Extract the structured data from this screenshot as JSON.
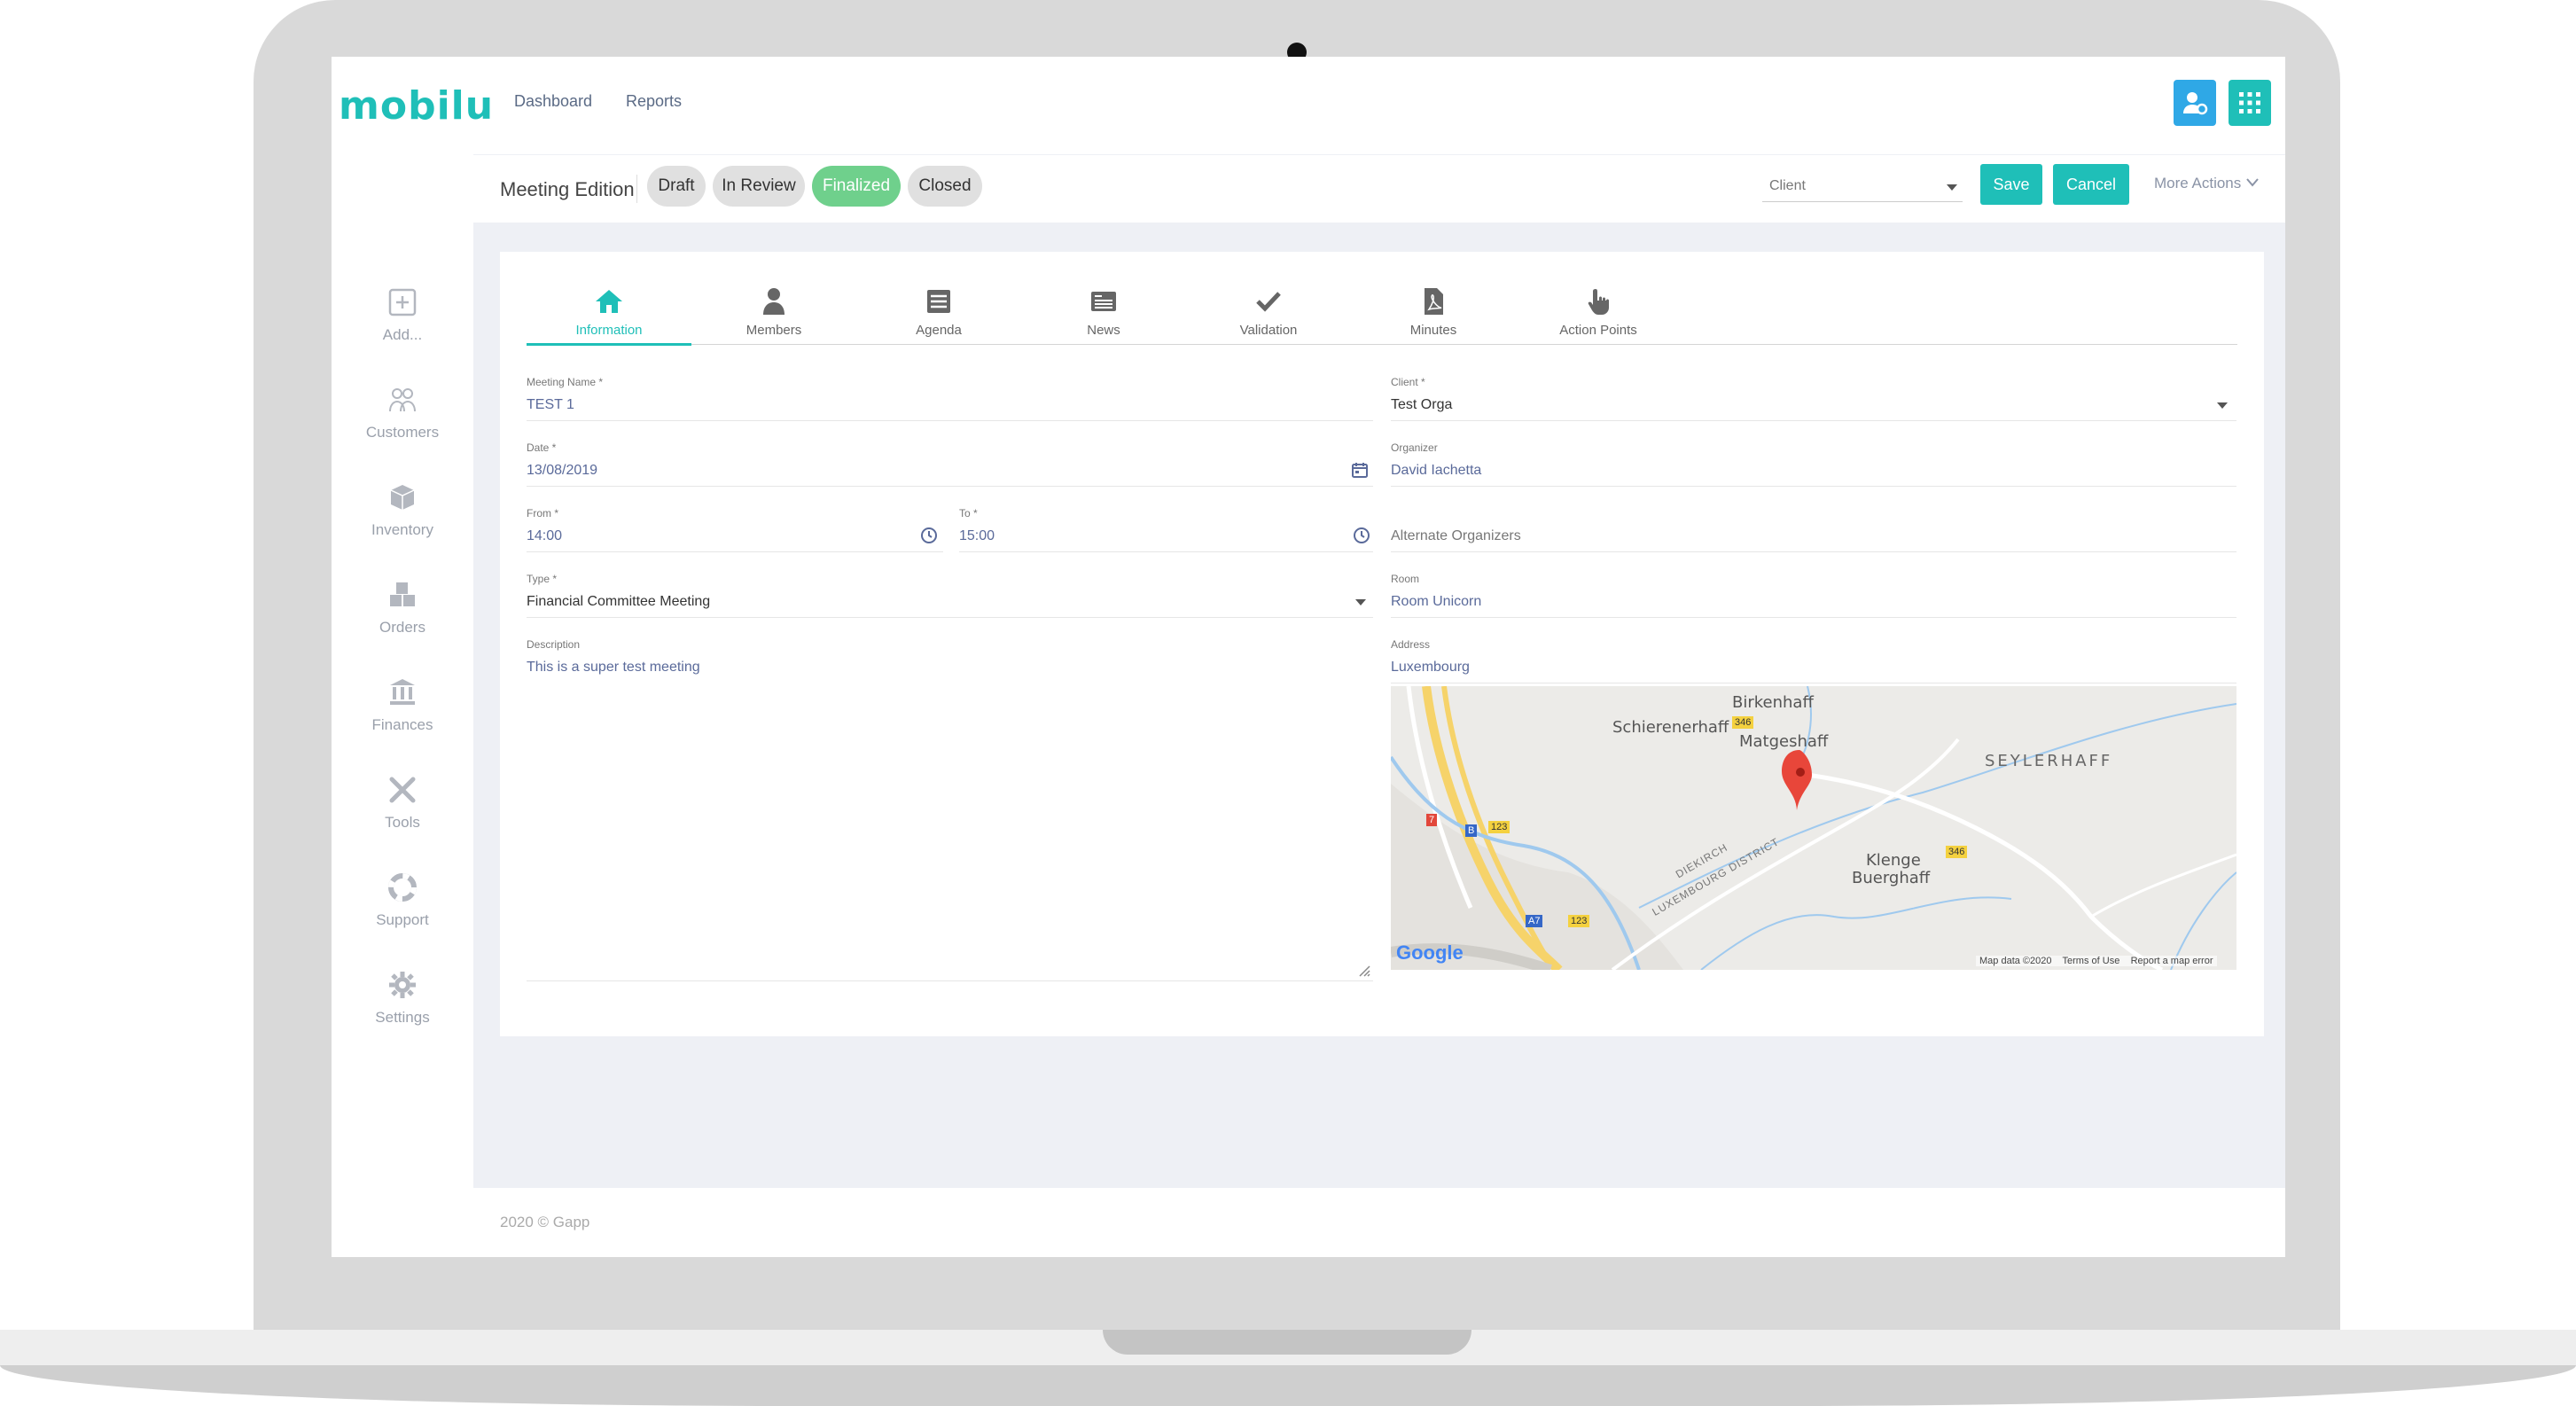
{
  "app": {
    "logo": "mobilu"
  },
  "topnav": {
    "dashboard": "Dashboard",
    "reports": "Reports"
  },
  "header_buttons": {
    "user_settings_icon": "user-gear-icon",
    "apps_icon": "grid-icon"
  },
  "sidebar": {
    "items": [
      {
        "label": "Add...",
        "icon": "plus-square-icon"
      },
      {
        "label": "Customers",
        "icon": "users-icon"
      },
      {
        "label": "Inventory",
        "icon": "box-icon"
      },
      {
        "label": "Orders",
        "icon": "boxes-icon"
      },
      {
        "label": "Finances",
        "icon": "bank-icon"
      },
      {
        "label": "Tools",
        "icon": "tools-icon"
      },
      {
        "label": "Support",
        "icon": "lifebuoy-icon"
      },
      {
        "label": "Settings",
        "icon": "gear-icon"
      }
    ]
  },
  "subheader": {
    "title": "Meeting Edition",
    "statuses": [
      {
        "label": "Draft",
        "active": false
      },
      {
        "label": "In Review",
        "active": false
      },
      {
        "label": "Finalized",
        "active": true
      },
      {
        "label": "Closed",
        "active": false
      }
    ],
    "client_select": "Client",
    "save": "Save",
    "cancel": "Cancel",
    "more_actions": "More Actions"
  },
  "tabs": [
    {
      "label": "Information",
      "icon": "home-icon",
      "active": true
    },
    {
      "label": "Members",
      "icon": "user-icon",
      "active": false
    },
    {
      "label": "Agenda",
      "icon": "list-icon",
      "active": false
    },
    {
      "label": "News",
      "icon": "newspaper-icon",
      "active": false
    },
    {
      "label": "Validation",
      "icon": "check-icon",
      "active": false
    },
    {
      "label": "Minutes",
      "icon": "pdf-file-icon",
      "active": false
    },
    {
      "label": "Action Points",
      "icon": "pointer-hand-icon",
      "active": false
    }
  ],
  "form": {
    "meeting_name": {
      "label": "Meeting Name *",
      "value": "TEST 1"
    },
    "date": {
      "label": "Date *",
      "value": "13/08/2019"
    },
    "from": {
      "label": "From *",
      "value": "14:00"
    },
    "to": {
      "label": "To *",
      "value": "15:00"
    },
    "type": {
      "label": "Type *",
      "value": "Financial Committee Meeting"
    },
    "description": {
      "label": "Description",
      "value": "This is a super test meeting"
    },
    "client": {
      "label": "Client *",
      "value": "Test Orga"
    },
    "organizer": {
      "label": "Organizer",
      "value": "David Iachetta"
    },
    "alternate_organizers": {
      "placeholder": "Alternate Organizers"
    },
    "room": {
      "label": "Room",
      "value": "Room Unicorn"
    },
    "address": {
      "label": "Address",
      "value": "Luxembourg"
    }
  },
  "map": {
    "places": [
      "Birkenhaff",
      "Schierenerhaff",
      "Matgeshaff",
      "SEYLERHAFF",
      "Klenge",
      "Buerghaff",
      "DIEKIRCH",
      "LUXEMBOURG DISTRICT"
    ],
    "road_badges": [
      "346",
      "123",
      "346",
      "123",
      "A7",
      "7",
      "B"
    ],
    "google": "Google",
    "attribution": [
      "Map data ©2020",
      "Terms of Use",
      "Report a map error"
    ]
  },
  "footer": "2020 © Gapp"
}
